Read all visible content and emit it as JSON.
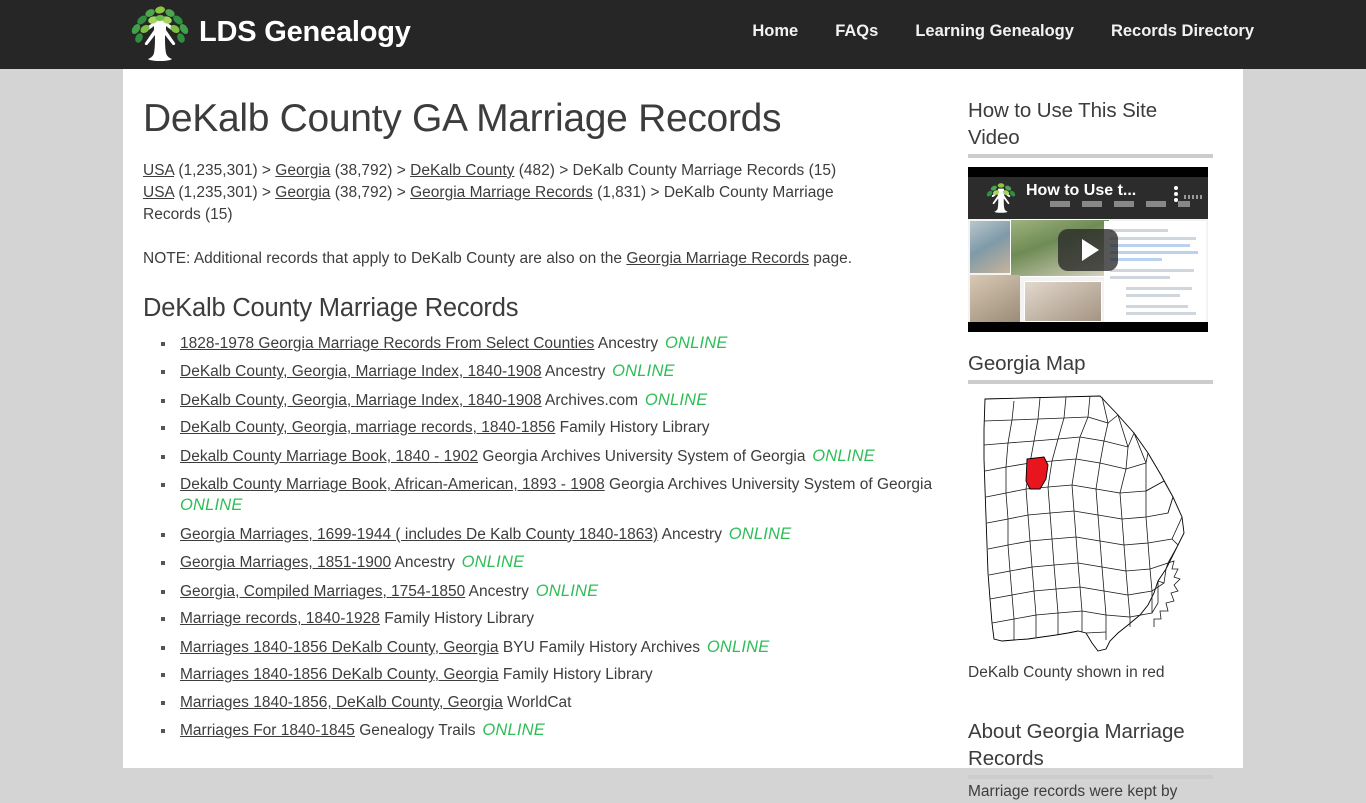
{
  "header": {
    "brand_name": "LDS Genealogy",
    "logo_icon": "tree-logo-icon",
    "nav": [
      {
        "label": "Home",
        "name": "nav-home"
      },
      {
        "label": "FAQs",
        "name": "nav-faqs"
      },
      {
        "label": "Learning Genealogy",
        "name": "nav-learning-genealogy"
      },
      {
        "label": "Records Directory",
        "name": "nav-records-directory"
      }
    ]
  },
  "main": {
    "page_title": "DeKalb County GA Marriage Records",
    "breadcrumb_1": [
      {
        "text": "USA",
        "link": true
      },
      {
        "text": " (1,235,301) > ",
        "link": false
      },
      {
        "text": "Georgia",
        "link": true
      },
      {
        "text": " (38,792) > ",
        "link": false
      },
      {
        "text": "DeKalb County",
        "link": true
      },
      {
        "text": " (482) > DeKalb County Marriage Records (15)",
        "link": false
      }
    ],
    "breadcrumb_2": [
      {
        "text": "USA",
        "link": true
      },
      {
        "text": " (1,235,301) > ",
        "link": false
      },
      {
        "text": "Georgia",
        "link": true
      },
      {
        "text": " (38,792) > ",
        "link": false
      },
      {
        "text": "Georgia Marriage Records",
        "link": true
      },
      {
        "text": " (1,831) > DeKalb County Marriage Records (15)",
        "link": false
      }
    ],
    "note_prefix": "NOTE: Additional records that apply to DeKalb County are also on the ",
    "note_link": "Georgia Marriage Records",
    "note_suffix": " page.",
    "section_title": "DeKalb County Marriage Records",
    "records": [
      {
        "title": "1828-1978 Georgia Marriage Records From Select Counties",
        "source": "Ancestry",
        "online": "ONLINE"
      },
      {
        "title": "DeKalb County, Georgia, Marriage Index, 1840-1908",
        "source": "Ancestry",
        "online": "ONLINE"
      },
      {
        "title": "DeKalb County, Georgia, Marriage Index, 1840-1908",
        "source": "Archives.com",
        "online": "ONLINE"
      },
      {
        "title": "DeKalb County, Georgia, marriage records, 1840-1856",
        "source": "Family History Library",
        "online": ""
      },
      {
        "title": "Dekalb County Marriage Book, 1840 - 1902",
        "source": "Georgia Archives University System of Georgia",
        "online": "ONLINE"
      },
      {
        "title": "Dekalb County Marriage Book, African-American, 1893 - 1908",
        "source": "Georgia Archives University System of Georgia",
        "online": "ONLINE"
      },
      {
        "title": "Georgia Marriages, 1699-1944 ( includes De Kalb County 1840-1863)",
        "source": "Ancestry",
        "online": "ONLINE"
      },
      {
        "title": "Georgia Marriages, 1851-1900",
        "source": "Ancestry",
        "online": "ONLINE"
      },
      {
        "title": "Georgia, Compiled Marriages, 1754-1850",
        "source": "Ancestry",
        "online": "ONLINE"
      },
      {
        "title": "Marriage records, 1840-1928",
        "source": "Family History Library",
        "online": ""
      },
      {
        "title": "Marriages 1840-1856 DeKalb County, Georgia",
        "source": "BYU Family History Archives",
        "online": "ONLINE"
      },
      {
        "title": "Marriages 1840-1856 DeKalb County, Georgia",
        "source": "Family History Library",
        "online": ""
      },
      {
        "title": "Marriages 1840-1856, DeKalb County, Georgia",
        "source": "WorldCat",
        "online": ""
      },
      {
        "title": "Marriages For 1840-1845",
        "source": "Genealogy Trails",
        "online": "ONLINE"
      }
    ]
  },
  "sidebar": {
    "video_heading": "How to Use This Site Video",
    "video_title": "How to Use t...",
    "map_heading": "Georgia Map",
    "map_caption": "DeKalb County shown in red",
    "about_heading": "About Georgia Marriage Records",
    "about_body": "Marriage records were kept by"
  },
  "colors": {
    "header_bg": "#262626",
    "page_bg": "#d4d4d4",
    "online_green": "#2ebd56",
    "county_red": "#e8141e",
    "rule_gray": "#cccccc"
  }
}
